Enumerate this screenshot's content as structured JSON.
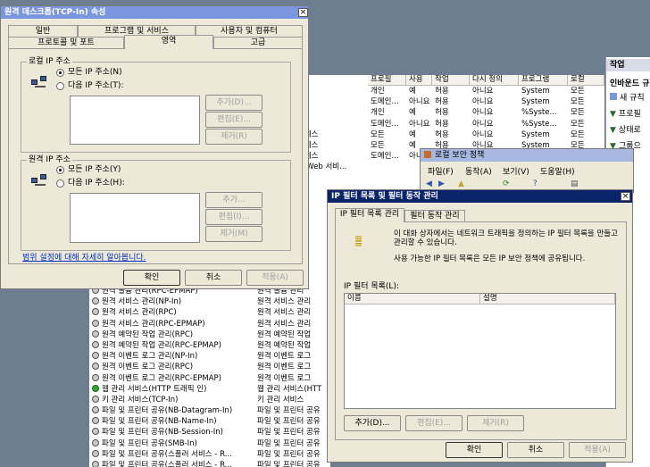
{
  "main_grid": {
    "headers": [
      "프로필",
      "사용",
      "작업",
      "다시 정의",
      "프로그램",
      "로컬"
    ],
    "rows": [
      [
        "",
        "개인",
        "예",
        "허용",
        "아니요",
        "System",
        "모든"
      ],
      [
        "",
        "도메인...",
        "아니요",
        "허용",
        "아니요",
        "System",
        "모든"
      ],
      [
        "",
        "개인",
        "예",
        "허용",
        "아니요",
        "%Syste...",
        "모든"
      ],
      [
        "",
        "도메인...",
        "아니요",
        "허용",
        "아니요",
        "%Syste...",
        "모든"
      ],
      [
        "액세스",
        "모든",
        "예",
        "허용",
        "아니요",
        "System",
        "모든"
      ],
      [
        "액세스",
        "모든",
        "예",
        "허용",
        "아니요",
        "System",
        "모든"
      ],
      [
        "액세스",
        "도메인...",
        "아니요",
        "허용",
        "아니요",
        "System",
        "모든"
      ]
    ],
    "partial_rows": [
      "le Web 서비...",
      "고",
      "고",
      "고"
    ],
    "lower_rows": [
      {
        "name": "원격 볼륨 관리(RPC-EPMAP)",
        "group": "원격 볼륨 관리",
        "green": false
      },
      {
        "name": "원격 서비스 관리(NP-In)",
        "group": "원격 서비스 관리",
        "green": false
      },
      {
        "name": "원격 서비스 관리(RPC)",
        "group": "원격 서비스 관리",
        "green": false
      },
      {
        "name": "원격 서비스 관리(RPC-EPMAP)",
        "group": "원격 서비스 관리",
        "green": false
      },
      {
        "name": "원격 예약된 작업 관리(RPC)",
        "group": "원격 예약된 작업",
        "green": false
      },
      {
        "name": "원격 예약된 작업 관리(RPC-EPMAP)",
        "group": "원격 예약된 작업",
        "green": false
      },
      {
        "name": "원격 이벤트 로그 관리(NP-In)",
        "group": "원격 이벤트 로그",
        "green": false
      },
      {
        "name": "원격 이벤트 로그 관리(RPC)",
        "group": "원격 이벤트 로그",
        "green": false
      },
      {
        "name": "원격 이벤트 로그 관리(RPC-EPMAP)",
        "group": "원격 이벤트 로그",
        "green": false
      },
      {
        "name": "웹 관리 서비스(HTTP 트래픽 인)",
        "group": "웹 관리 서비스(HTT",
        "green": true
      },
      {
        "name": "키 관리 서비스(TCP-In)",
        "group": "키 관리 서비스",
        "green": false
      },
      {
        "name": "파일 및 프린터 공유(NB-Datagram-In)",
        "group": "파일 및 프린터 공유",
        "green": false
      },
      {
        "name": "파일 및 프린터 공유(NB-Name-In)",
        "group": "파일 및 프린터 공유",
        "green": false
      },
      {
        "name": "파일 및 프린터 공유(NB-Session-In)",
        "group": "파일 및 프린터 공유",
        "green": false
      },
      {
        "name": "파일 및 프린터 공유(SMB-In)",
        "group": "파일 및 프린터 공유",
        "green": false
      },
      {
        "name": "파일 및 프린터 공유(스풀러 서비스 - R...",
        "group": "파일 및 프린터 공유",
        "green": false
      },
      {
        "name": "파일 및 프린터 공유(스풀러 서비스 - R...",
        "group": "파일 및 프린터 공유",
        "green": false
      }
    ]
  },
  "actions_pane": {
    "title": "작업",
    "section": "인바운드 규",
    "items": [
      "새 규칙",
      "프로필",
      "상태로",
      "그룹으"
    ]
  },
  "props_dialog": {
    "title": "원격 데스크톱(TCP-In) 속성",
    "tabs_row1": [
      "일반",
      "프로그램 및 서비스",
      "사용자 및 컴퓨터"
    ],
    "tabs_row2": [
      "프로토콜 및 포트",
      "영역",
      "고급"
    ],
    "local": {
      "title": "로컬 IP 주소",
      "any": "모든 IP 주소(N)",
      "these": "다음 IP 주소(T):",
      "add": "추가(D)...",
      "edit": "편집(E)...",
      "remove": "제거(R)"
    },
    "remote": {
      "title": "원격 IP 주소",
      "any": "모든 IP 주소(Y)",
      "these": "다음 IP 주소(H):",
      "add": "추가...",
      "edit": "편집(I)...",
      "remove": "제거(M)"
    },
    "link": "범위 설정에 대해 자세히 알아봅니다.",
    "ok": "확인",
    "cancel": "취소",
    "apply": "적용(A)"
  },
  "lsp_window": {
    "title": "로컬 보안 정책",
    "menu": [
      "파일(F)",
      "동작(A)",
      "보기(V)",
      "도움말(H)"
    ]
  },
  "ipf_dialog": {
    "title": "IP 필터 목록 및 필터 동작 관리",
    "tabs": [
      "IP 필터 목록 관리",
      "필터 동작 관리"
    ],
    "desc1": "이 대화 상자에서는 네트워크 트래픽을 정의하는 IP 필터 목록을 만들고 관리할 수 있습니다.",
    "desc2": "사용 가능한 IP 필터 목록은 모든 IP 보안 정책에 공유됩니다.",
    "list_label": "IP 필터 목록(L):",
    "col_name": "이름",
    "col_desc": "설명",
    "add": "추가(D)...",
    "edit": "편집(E)...",
    "remove": "제거(R)",
    "ok": "확인",
    "cancel": "취소",
    "apply": "적용(A)"
  },
  "colors": {
    "title_active": "#0a246a",
    "title_inactive": "#7a96df",
    "dialog_bg": "#ece9d8",
    "link": "#0030c0"
  }
}
